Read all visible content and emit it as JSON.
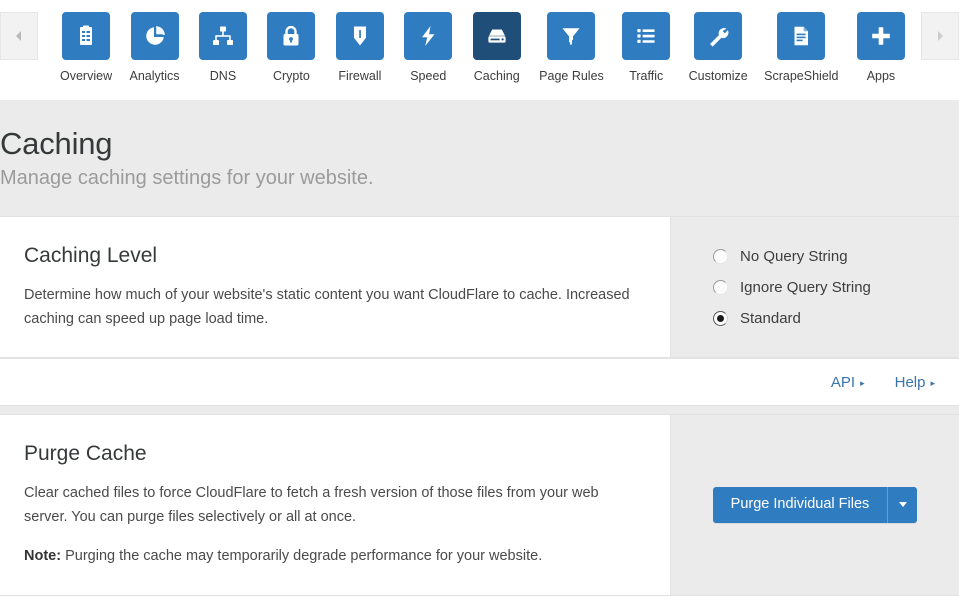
{
  "nav": {
    "prev_arrow": "chevron-left",
    "next_arrow": "chevron-right",
    "active": "Caching",
    "items": [
      {
        "label": "Overview",
        "icon": "clipboard-icon"
      },
      {
        "label": "Analytics",
        "icon": "pie-chart-icon"
      },
      {
        "label": "DNS",
        "icon": "sitemap-icon"
      },
      {
        "label": "Crypto",
        "icon": "lock-icon"
      },
      {
        "label": "Firewall",
        "icon": "shield-icon"
      },
      {
        "label": "Speed",
        "icon": "lightning-bolt-icon"
      },
      {
        "label": "Caching",
        "icon": "hard-drive-icon"
      },
      {
        "label": "Page Rules",
        "icon": "funnel-icon"
      },
      {
        "label": "Traffic",
        "icon": "list-icon"
      },
      {
        "label": "Customize",
        "icon": "wrench-icon"
      },
      {
        "label": "ScrapeShield",
        "icon": "document-icon"
      },
      {
        "label": "Apps",
        "icon": "plus-icon"
      }
    ]
  },
  "header": {
    "title": "Caching",
    "subtitle": "Manage caching settings for your website."
  },
  "caching_level": {
    "heading": "Caching Level",
    "body": "Determine how much of your website's static content you want CloudFlare to cache. Increased caching can speed up page load time.",
    "options": [
      {
        "label": "No Query String",
        "selected": false
      },
      {
        "label": "Ignore Query String",
        "selected": false
      },
      {
        "label": "Standard",
        "selected": true
      }
    ],
    "selected_value": "Standard"
  },
  "links": {
    "api": "API",
    "help": "Help",
    "caret": "▸"
  },
  "purge_cache": {
    "heading": "Purge Cache",
    "body": "Clear cached files to force CloudFlare to fetch a fresh version of those files from your web server. You can purge files selectively or all at once.",
    "note_label": "Note:",
    "note_text": " Purging the cache may temporarily degrade performance for your website.",
    "button_label": "Purge Individual Files",
    "button_dropdown": "caret-down-icon"
  },
  "colors": {
    "tile_blue": "#2f7dc0",
    "tile_active_blue": "#1f4e79",
    "link_blue": "#3a74ab",
    "band_gray": "#ebebeb",
    "text_dark": "#36393a",
    "text_muted": "#9b9b9b"
  }
}
